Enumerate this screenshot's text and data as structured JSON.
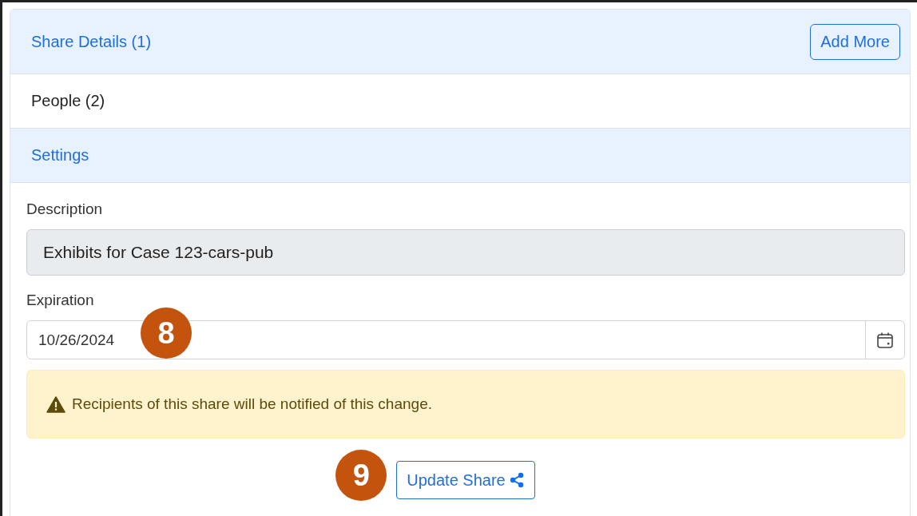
{
  "sections": [
    {
      "title": "Share Details (1)",
      "highlighted": true,
      "button": "Add More"
    },
    {
      "title": "People (2)",
      "highlighted": false
    },
    {
      "title": "Settings",
      "highlighted": true
    }
  ],
  "form": {
    "description_label": "Description",
    "description_value": "Exhibits for Case 123-cars-pub",
    "expiration_label": "Expiration",
    "expiration_value": "10/26/2024"
  },
  "alert": "Recipients of this share will be notified of this change.",
  "submit_button": "Update Share",
  "callouts": [
    "8",
    "9"
  ]
}
